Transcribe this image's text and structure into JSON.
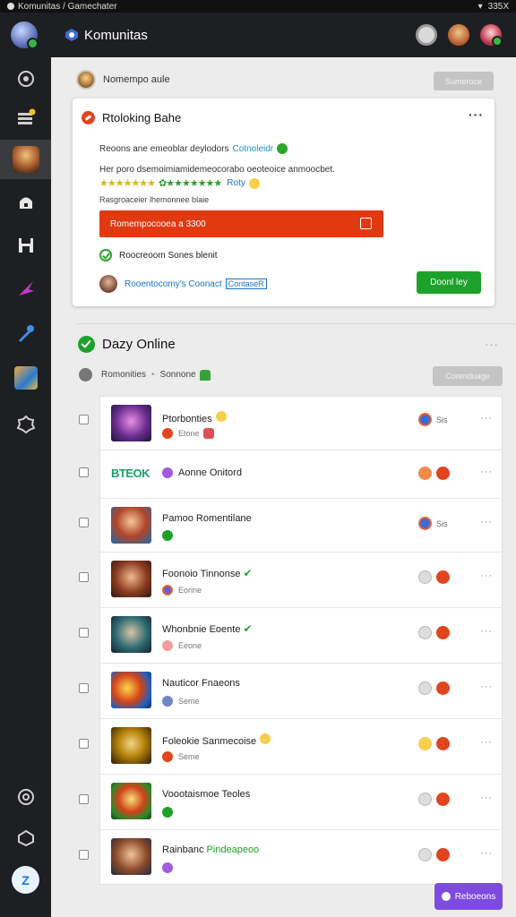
{
  "status_bar": {
    "left_text": "Komunitas / Gamechater",
    "right_text": "335X"
  },
  "brand": {
    "title": "Komunitas"
  },
  "announcement": {
    "author": "Nomempo aule",
    "button": "Sumeroce"
  },
  "card": {
    "title": "Rtoloking Bahe",
    "line1": "Reoons ane emeoblar deylodors",
    "line1_link": "Cotnoleidr",
    "line2": "Her poro dsemoimiamidemeocorabo oeoteoice anmoocbet.",
    "line3_link": "Roty",
    "line4": "Rasgroaceier lhemonnee blaie",
    "banner": "Romempocooea a 3300",
    "check_label": "Roocreoom Sones blenit",
    "user_name": "Rooentocomy's Coonact",
    "user_tag": "ContaseR",
    "action_button": "Doonl ley"
  },
  "section": {
    "title": "Dazy Online",
    "filter_a": "Romonities",
    "filter_b": "Sonnone",
    "sort_button": "Corenduage"
  },
  "rows": [
    {
      "title": "Ptorbonties",
      "sub": "Etone"
    },
    {
      "logo": "BTEOK",
      "title": "Aonne Onitord"
    },
    {
      "title": "Pamoo Romentilane",
      "meta": "Sis"
    },
    {
      "title": "Foonoio Tinnonse",
      "sub": "Eorine"
    },
    {
      "title": "Whonbnie Eoente",
      "sub": "Eeone"
    },
    {
      "title": "Nauticor Fnaeons",
      "sub": "Seme"
    },
    {
      "title": "Foleokie Sanmecoise",
      "sub": "Seme"
    },
    {
      "title": "Voootaismoe Teoles"
    },
    {
      "title": "Rainbanc",
      "title_hl": "Pindeapeoo"
    }
  ],
  "row_meta": {
    "first": "Sis"
  },
  "fab": {
    "label": "Reboeons"
  }
}
